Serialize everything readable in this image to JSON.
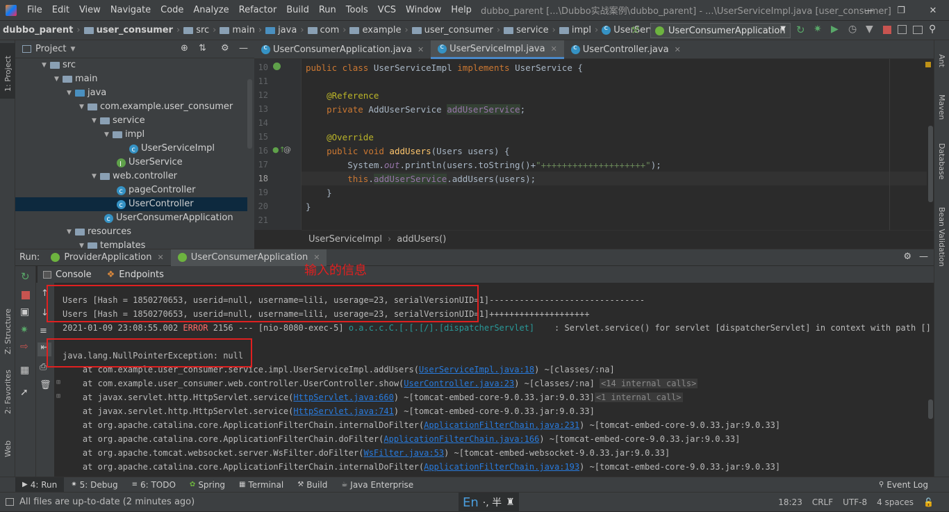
{
  "title_bar": {
    "menu": [
      "File",
      "Edit",
      "View",
      "Navigate",
      "Code",
      "Analyze",
      "Refactor",
      "Build",
      "Run",
      "Tools",
      "VCS",
      "Window",
      "Help"
    ],
    "title": "dubbo_parent [...\\Dubbo实战案例\\dubbo_parent] - ...\\UserServiceImpl.java [user_consumer]"
  },
  "breadcrumbs": [
    "dubbo_parent",
    "user_consumer",
    "src",
    "main",
    "java",
    "com",
    "example",
    "user_consumer",
    "service",
    "impl",
    "UserServiceImpl"
  ],
  "run_config": "UserConsumerApplication",
  "left_strip": {
    "project": "1: Project",
    "structure": "Z: Structure",
    "favorites": "2: Favorites",
    "web": "Web"
  },
  "right_strip": [
    "Ant",
    "Maven",
    "Database",
    "Bean Validation"
  ],
  "project_panel": {
    "title": "Project",
    "tree": [
      {
        "label": "src",
        "type": "folder",
        "indent": 0
      },
      {
        "label": "main",
        "type": "folder",
        "indent": 1
      },
      {
        "label": "java",
        "type": "folder",
        "indent": 2
      },
      {
        "label": "com.example.user_consumer",
        "type": "package",
        "indent": 3
      },
      {
        "label": "service",
        "type": "package",
        "indent": 4
      },
      {
        "label": "impl",
        "type": "package",
        "indent": 5
      },
      {
        "label": "UserServiceImpl",
        "type": "class",
        "indent": 6
      },
      {
        "label": "UserService",
        "type": "interface",
        "indent": 5
      },
      {
        "label": "web.controller",
        "type": "package",
        "indent": 4
      },
      {
        "label": "pageController",
        "type": "class",
        "indent": 5
      },
      {
        "label": "UserController",
        "type": "class",
        "indent": 5,
        "selected": true
      },
      {
        "label": "UserConsumerApplication",
        "type": "class",
        "indent": 4
      },
      {
        "label": "resources",
        "type": "folder",
        "indent": 2
      },
      {
        "label": "templates",
        "type": "folder",
        "indent": 3
      }
    ]
  },
  "editor_tabs": [
    {
      "label": "UserConsumerApplication.java",
      "active": false
    },
    {
      "label": "UserServiceImpl.java",
      "active": true
    },
    {
      "label": "UserController.java",
      "active": false
    }
  ],
  "line_numbers": [
    "10",
    "11",
    "12",
    "13",
    "14",
    "15",
    "16",
    "17",
    "18",
    "19",
    "20",
    "21"
  ],
  "code_crumbs": [
    "UserServiceImpl",
    "addUsers()"
  ],
  "run_panel": {
    "label": "Run:",
    "tabs": [
      "ProviderApplication",
      "UserConsumerApplication"
    ],
    "sub_tabs": [
      "Console",
      "Endpoints"
    ],
    "annotation": "输入的信息"
  },
  "console_lines": {
    "l1": "Users [Hash = 1850270653, userid=null, username=lili, userage=23, serialVersionUID=1]-------------------------------",
    "l2": "Users [Hash = 1850270653, userid=null, username=lili, userage=23, serialVersionUID=1]++++++++++++++++++++",
    "l3_time": "2021-01-09 23:08:55.002 ",
    "l3_level": "ERROR",
    "l3_mid": " 2156 --- [nio-8080-exec-5] ",
    "l3_logger": "o.a.c.c.C.[.[.[/].[dispatcherServlet]",
    "l3_msg": "    : Servlet.service() for servlet [dispatcherServlet] in context with path [] threw",
    "l5": "java.lang.NullPointerException: null",
    "l6_pre": "    at com.example.user_consumer.service.impl.UserServiceImpl.addUsers(",
    "l6_link": "UserServiceImpl.java:18",
    "l6_post": ") ~[classes/:na]",
    "l7_pre": "    at com.example.user_consumer.web.controller.UserController.show(",
    "l7_link": "UserController.java:23",
    "l7_post": ") ~[classes/:na] ",
    "l7_badge": "<14 internal calls>",
    "l8_pre": "    at javax.servlet.http.HttpServlet.service(",
    "l8_link": "HttpServlet.java:660",
    "l8_post": ") ~[tomcat-embed-core-9.0.33.jar:9.0.33]",
    "l8_badge": "<1 internal call>",
    "l9_pre": "    at javax.servlet.http.HttpServlet.service(",
    "l9_link": "HttpServlet.java:741",
    "l9_post": ") ~[tomcat-embed-core-9.0.33.jar:9.0.33]",
    "l10_pre": "    at org.apache.catalina.core.ApplicationFilterChain.internalDoFilter(",
    "l10_link": "ApplicationFilterChain.java:231",
    "l10_post": ") ~[tomcat-embed-core-9.0.33.jar:9.0.33]",
    "l11_pre": "    at org.apache.catalina.core.ApplicationFilterChain.doFilter(",
    "l11_link": "ApplicationFilterChain.java:166",
    "l11_post": ") ~[tomcat-embed-core-9.0.33.jar:9.0.33]",
    "l12_pre": "    at org.apache.tomcat.websocket.server.WsFilter.doFilter(",
    "l12_link": "WsFilter.java:53",
    "l12_post": ") ~[tomcat-embed-websocket-9.0.33.jar:9.0.33]",
    "l13_pre": "    at org.apache.catalina.core.ApplicationFilterChain.internalDoFilter(",
    "l13_link": "ApplicationFilterChain.java:193",
    "l13_post": ") ~[tomcat-embed-core-9.0.33.jar:9.0.33]"
  },
  "tool_tabs": [
    "4: Run",
    "5: Debug",
    "6: TODO",
    "Spring",
    "Terminal",
    "Build",
    "Java Enterprise",
    "Event Log"
  ],
  "status": {
    "message": "All files are up-to-date (2 minutes ago)",
    "ime": "En",
    "ime_extra": "·, 半",
    "position": "18:23",
    "line_sep": "CRLF",
    "encoding": "UTF-8",
    "indent": "4 spaces"
  }
}
